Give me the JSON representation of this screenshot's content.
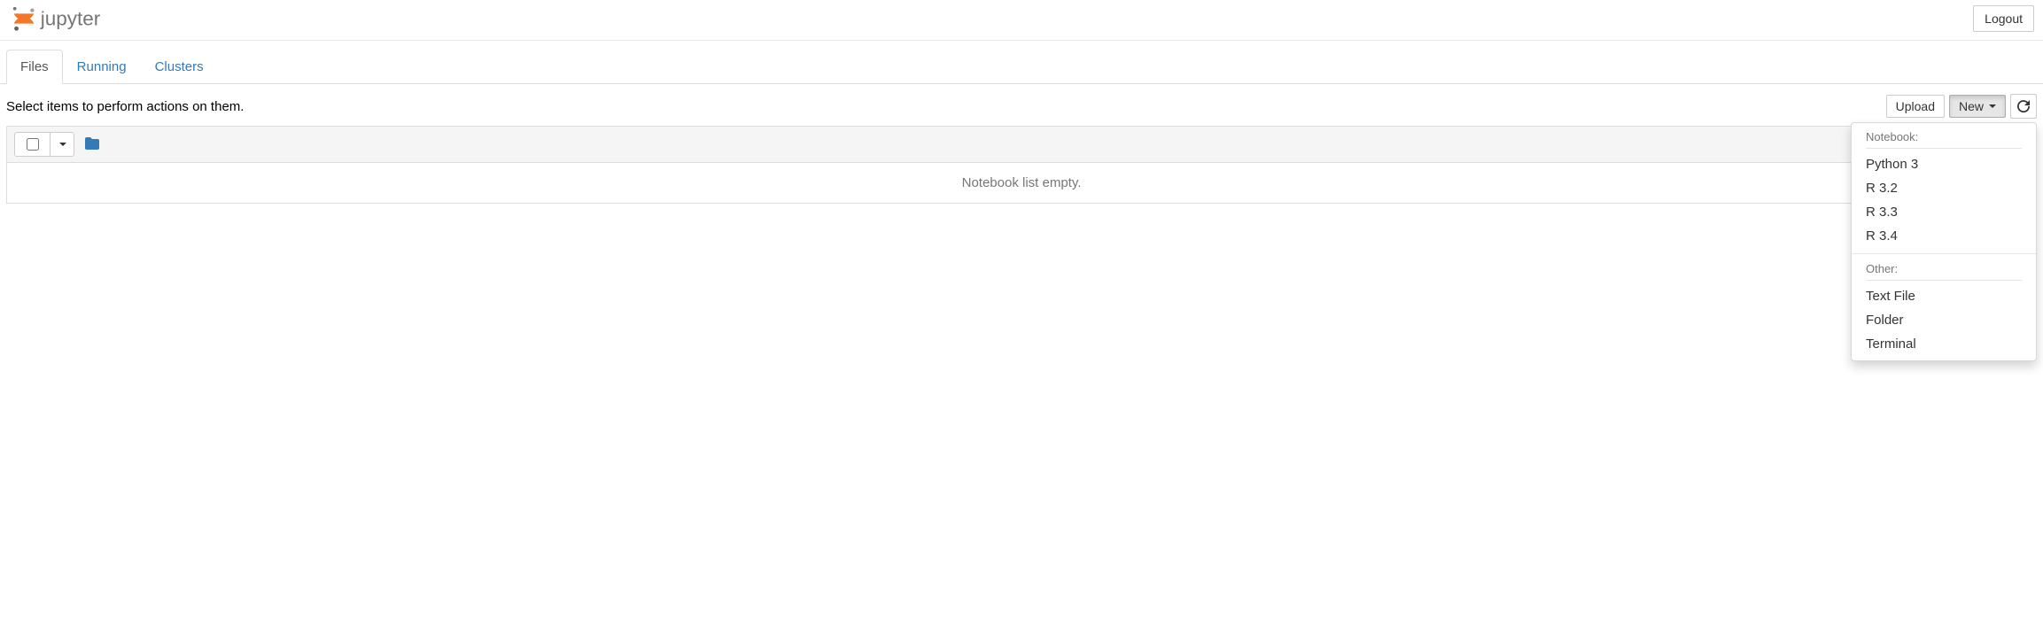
{
  "header": {
    "brand": "jupyter",
    "logout": "Logout"
  },
  "tabs": {
    "items": [
      {
        "label": "Files",
        "active": true
      },
      {
        "label": "Running",
        "active": false
      },
      {
        "label": "Clusters",
        "active": false
      }
    ]
  },
  "toolbar": {
    "hint": "Select items to perform actions on them.",
    "upload": "Upload",
    "new": "New"
  },
  "new_menu": {
    "section1_header": "Notebook:",
    "section1_items": [
      "Python 3",
      "R 3.2",
      "R 3.3",
      "R 3.4"
    ],
    "section2_header": "Other:",
    "section2_items": [
      "Text File",
      "Folder",
      "Terminal"
    ]
  },
  "list": {
    "empty_message": "Notebook list empty."
  }
}
